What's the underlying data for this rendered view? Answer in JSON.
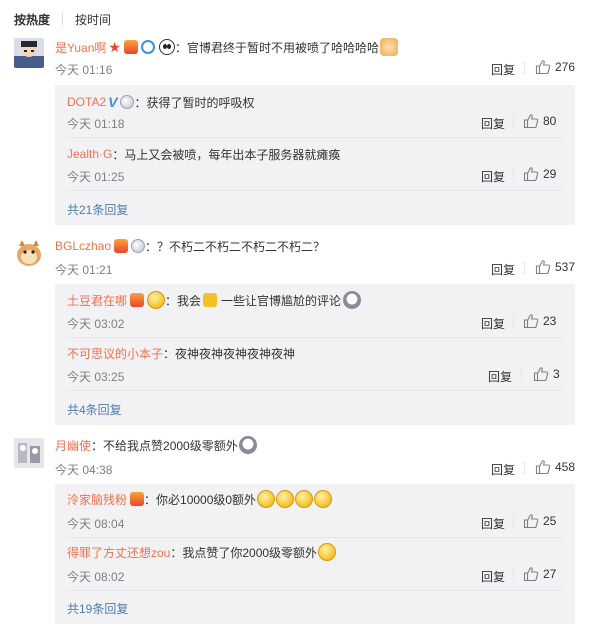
{
  "sort": {
    "hot": "按热度",
    "time": "按时间"
  },
  "comments": [
    {
      "user": "是Yuan啊",
      "text": "：官博君终于暂时不用被喷了哈哈哈哈",
      "time": "今天 01:16",
      "reply": "回复",
      "likes": "276",
      "replies": [
        {
          "user": "DOTA2",
          "text": "：获得了暂时的呼吸权",
          "time": "今天 01:18",
          "reply": "回复",
          "likes": "80"
        },
        {
          "user": "Jealth·G",
          "text": "：马上又会被喷，每年出本子服务器就瘫痪",
          "time": "今天 01:25",
          "reply": "回复",
          "likes": "29"
        }
      ],
      "more": "共21条回复"
    },
    {
      "user": "BGLczhao",
      "text": "：？不朽二不朽二不朽二不朽二？",
      "time": "今天 01:21",
      "reply": "回复",
      "likes": "537",
      "replies": [
        {
          "user": "土豆君在哪",
          "text": "：我会",
          "text2": "一些让官博尴尬的评论",
          "time": "今天 03:02",
          "reply": "回复",
          "likes": "23"
        },
        {
          "user": "不可思议的小本子",
          "text": "：夜神夜神夜神夜神夜神",
          "time": "今天 03:25",
          "reply": "回复",
          "likes": "3"
        }
      ],
      "more": "共4条回复"
    },
    {
      "user": "月幽使",
      "text": "：不给我点赞2000级零额外",
      "time": "今天 04:38",
      "reply": "回复",
      "likes": "458",
      "replies": [
        {
          "user": "泠家脑残粉",
          "text": "：你必10000级0额外",
          "time": "今天 08:04",
          "reply": "回复",
          "likes": "25"
        },
        {
          "user": "得罪了方丈还想zou",
          "text": "：我点赞了你2000级零额外",
          "time": "今天 08:02",
          "reply": "回复",
          "likes": "27"
        }
      ],
      "more": "共19条回复"
    }
  ],
  "colors": {
    "username": "#eb7350",
    "link": "#507daf",
    "subbg": "#f2f2f5"
  },
  "icons": [
    "thumb-up-icon",
    "vip-badge-icon",
    "verified-v-icon",
    "medal-icon",
    "emoji-icon",
    "panda-icon"
  ]
}
